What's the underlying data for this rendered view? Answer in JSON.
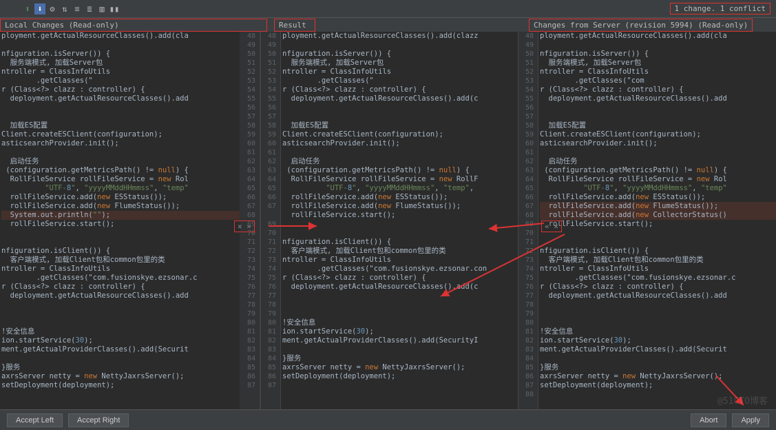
{
  "status": {
    "change_count": "1 change. 1 conflict"
  },
  "titles": {
    "local": "Local Changes (Read-only)",
    "result": "Result",
    "server": "Changes from Server (revision 5994) (Read-only)"
  },
  "buttons": {
    "accept_left": "Accept Left",
    "accept_right": "Accept Right",
    "abort": "Abort",
    "apply": "Apply"
  },
  "merge_controls": {
    "left": "✕ »",
    "right": "« ✕"
  },
  "gutters": {
    "left": [
      48,
      49,
      50,
      51,
      52,
      53,
      54,
      55,
      56,
      57,
      58,
      59,
      60,
      61,
      62,
      63,
      64,
      65,
      66,
      67,
      68,
      69,
      70,
      71,
      72,
      73,
      74,
      75,
      76,
      77,
      78,
      79,
      80,
      81,
      82,
      83,
      84,
      85,
      86,
      87
    ],
    "mid": [
      48,
      49,
      50,
      51,
      52,
      53,
      54,
      55,
      56,
      57,
      58,
      59,
      60,
      61,
      62,
      63,
      64,
      65,
      66,
      67,
      "",
      69,
      70,
      71,
      72,
      73,
      74,
      75,
      76,
      77,
      78,
      79,
      80,
      81,
      82,
      83,
      84,
      85,
      86,
      87
    ],
    "right": [
      48,
      49,
      50,
      51,
      52,
      53,
      54,
      55,
      56,
      57,
      58,
      59,
      60,
      61,
      62,
      63,
      64,
      65,
      66,
      67,
      68,
      69,
      70,
      71,
      72,
      73,
      74,
      75,
      76,
      77,
      78,
      79,
      80,
      81,
      82,
      83,
      84,
      85,
      86,
      87,
      88
    ]
  },
  "code": {
    "left": [
      "ployment.getActualResourceClasses().add(cla",
      "",
      "nfiguration.isServer()) {",
      "  服务端模式, 加载Server包",
      "ntroller = ClassInfoUtils",
      "        .getClasses(\"",
      "r (Class<?> clazz : controller) {",
      "  deployment.getActualResourceClasses().add",
      "",
      "",
      "  加载ES配置",
      "Client.createESClient(configuration);",
      "asticsearchProvider.init();",
      "",
      "  启动任务",
      " (configuration.getMetricsPath() != null) {",
      "  RollFileService rollFileService = new Rol",
      "          \"UTF-8\", \"yyyyMMddHHmmss\", \"temp\"",
      "  rollFileService.add(new ESStatus());",
      "  rollFileService.add(new FlumeStatus());",
      "  System.out.println(\"\");",
      "  rollFileService.start();",
      "",
      "",
      "nfiguration.isClient()) {",
      "  客户端模式, 加载Client包和common包里的类",
      "ntroller = ClassInfoUtils",
      "        .getClasses(\"com.fusionskye.ezsonar.c",
      "r (Class<?> clazz : controller) {",
      "  deployment.getActualResourceClasses().add",
      "",
      "",
      "",
      "!安全信息",
      "ion.startService(30);",
      "ment.getActualProviderClasses().add(Securit",
      "",
      "}服务",
      "axrsServer netty = new NettyJaxrsServer();",
      "setDeployment(deployment);"
    ],
    "mid": [
      "ployment.getActualResourceClasses().add(clazz",
      "",
      "nfiguration.isServer()) {",
      "  服务端模式, 加载Server包",
      "ntroller = ClassInfoUtils",
      "        .getClasses(\"",
      "r (Class<?> clazz : controller) {",
      "  deployment.getActualResourceClasses().add(c",
      "",
      "",
      "  加载ES配置",
      "Client.createESClient(configuration);",
      "asticsearchProvider.init();",
      "",
      "  启动任务",
      " (configuration.getMetricsPath() != null) {",
      "  RollFileService rollFileService = new RollF",
      "          \"UTF-8\", \"yyyyMMddHHmmss\", \"temp\",",
      "  rollFileService.add(new ESStatus());",
      "  rollFileService.add(new FlumeStatus());",
      "  rollFileService.start();",
      "",
      "",
      "nfiguration.isClient()) {",
      "  客户端模式, 加载Client包和common包里的类",
      "ntroller = ClassInfoUtils",
      "        .getClasses(\"com.fusionskye.ezsonar.con",
      "r (Class<?> clazz : controller) {",
      "  deployment.getActualResourceClasses().add(c",
      "",
      "",
      "",
      "!安全信息",
      "ion.startService(30);",
      "ment.getActualProviderClasses().add(SecurityI",
      "",
      "}服务",
      "axrsServer netty = new NettyJaxrsServer();",
      "setDeployment(deployment);",
      ""
    ],
    "right": [
      "ployment.getActualResourceClasses().add(cla",
      "",
      "nfiguration.isServer()) {",
      "  服务端模式, 加载Server包",
      "ntroller = ClassInfoUtils",
      "        .getClasses(\"com",
      "r (Class<?> clazz : controller) {",
      "  deployment.getActualResourceClasses().add",
      "",
      "",
      "  加载ES配置",
      "Client.createESClient(configuration);",
      "asticsearchProvider.init();",
      "",
      "  启动任务",
      " (configuration.getMetricsPath() != null) {",
      "  RollFileService rollFileService = new Rol",
      "          \"UTF-8\", \"yyyyMMddHHmmss\", \"temp\"",
      "  rollFileService.add(new ESStatus());",
      "  rollFileService.add(new FlumeStatus());",
      "  rollFileService.add(new CollectorStatus()",
      "  rollFileService.start();",
      "",
      "",
      "nfiguration.isClient()) {",
      "  客户端模式, 加载Client包和common包里的类",
      "ntroller = ClassInfoUtils",
      "        .getClasses(\"com.fusionskye.ezsonar.c",
      "r (Class<?> clazz : controller) {",
      "  deployment.getActualResourceClasses().add",
      "",
      "",
      "",
      "!安全信息",
      "ion.startService(30);",
      "ment.getActualProviderClasses().add(Securit",
      "",
      "}服务",
      "axrsServer netty = new NettyJaxrsServer();",
      "setDeployment(deployment);",
      ""
    ]
  },
  "highlights": {
    "left": {
      "conflict": [
        20
      ]
    },
    "mid": {
      "conflict": []
    },
    "right": {
      "conflict": [
        19,
        20
      ]
    }
  },
  "watermark": "@51CTO博客"
}
